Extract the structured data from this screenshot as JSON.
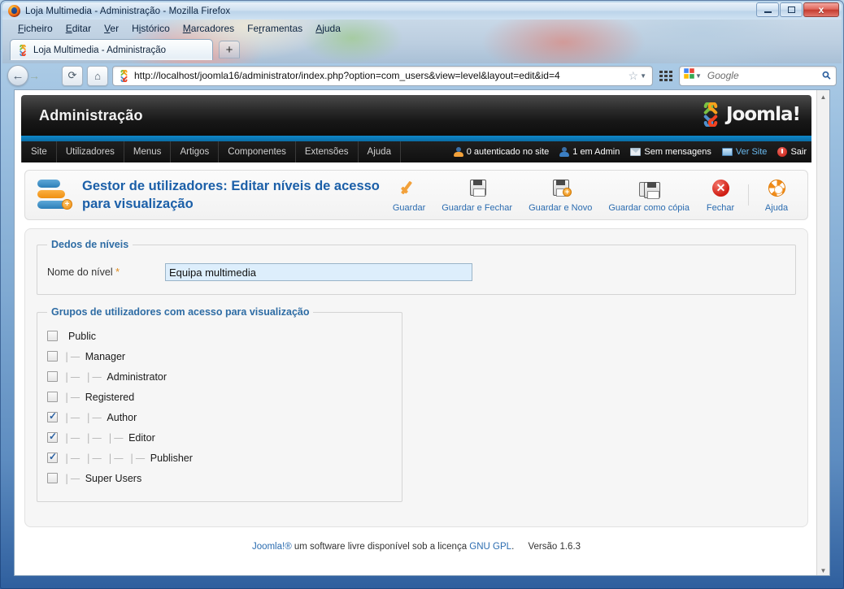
{
  "window": {
    "title": "Loja Multimedia - Administração - Mozilla Firefox",
    "minimize_label": "",
    "maximize_label": "",
    "close_label": "x"
  },
  "menubar": [
    {
      "label": "Ficheiro"
    },
    {
      "label": "Editar"
    },
    {
      "label": "Ver"
    },
    {
      "label": "Histórico"
    },
    {
      "label": "Marcadores"
    },
    {
      "label": "Ferramentas"
    },
    {
      "label": "Ajuda"
    }
  ],
  "tab": {
    "title": "Loja Multimedia - Administração",
    "new_tab_label": "+"
  },
  "nav": {
    "back_label": "←",
    "forward_label": "→",
    "reload_label": "⟳",
    "home_label": "⌂",
    "url": "http://localhost/joomla16/administrator/index.php?option=com_users&view=level&layout=edit&id=4",
    "bookmark_label": "☆",
    "search_placeholder": "Google",
    "search_value": "",
    "search_engine": "Google"
  },
  "joomla": {
    "header_title": "Administração",
    "brand": "Joomla!",
    "menu": [
      {
        "label": "Site"
      },
      {
        "label": "Utilizadores"
      },
      {
        "label": "Menus"
      },
      {
        "label": "Artigos"
      },
      {
        "label": "Componentes"
      },
      {
        "label": "Extensões"
      },
      {
        "label": "Ajuda"
      }
    ],
    "status": [
      {
        "label": "0 autenticado no site",
        "icon": "user-icon",
        "link": false
      },
      {
        "label": "1 em Admin",
        "icon": "user-icon",
        "link": false
      },
      {
        "label": "Sem mensagens",
        "icon": "mail-icon",
        "link": false
      },
      {
        "label": "Ver Site",
        "icon": "screen-icon",
        "link": true
      },
      {
        "label": "Sair",
        "icon": "power-icon",
        "link": false
      }
    ]
  },
  "page": {
    "title": "Gestor de utilizadores: Editar níveis de acesso para visualização",
    "toolbar": [
      {
        "label": "Guardar",
        "icon": "check-icon"
      },
      {
        "label": "Guardar e Fechar",
        "icon": "floppy-icon"
      },
      {
        "label": "Guardar e Novo",
        "icon": "floppy-plus-icon"
      },
      {
        "label": "Guardar como cópia",
        "icon": "floppy-copy-icon"
      },
      {
        "label": "Fechar",
        "icon": "close-circle-icon"
      },
      {
        "label": "Ajuda",
        "icon": "lifering-icon"
      }
    ]
  },
  "form": {
    "details_legend": "Dedos de níveis",
    "level_name_label": "Nome do nível",
    "required_marker": "*",
    "level_name_value": "Equipa multimedia",
    "groups_legend": "Grupos de utilizadores com acesso para visualização",
    "groups": [
      {
        "name": "Public",
        "depth": 0,
        "checked": false
      },
      {
        "name": "Manager",
        "depth": 1,
        "checked": false
      },
      {
        "name": "Administrator",
        "depth": 2,
        "checked": false
      },
      {
        "name": "Registered",
        "depth": 1,
        "checked": false
      },
      {
        "name": "Author",
        "depth": 2,
        "checked": true
      },
      {
        "name": "Editor",
        "depth": 3,
        "checked": true
      },
      {
        "name": "Publisher",
        "depth": 4,
        "checked": true
      },
      {
        "name": "Super Users",
        "depth": 1,
        "checked": false
      }
    ]
  },
  "footer": {
    "brand": "Joomla!®",
    "text": " um software livre disponível sob a licença ",
    "license": "GNU GPL",
    "period": ".",
    "version": "Versão 1.6.3"
  },
  "colors": {
    "accent_blue": "#2b6cb0",
    "joomla_orange": "#f2a13a",
    "header_black": "#171717",
    "link_blue": "#69b9ee"
  }
}
